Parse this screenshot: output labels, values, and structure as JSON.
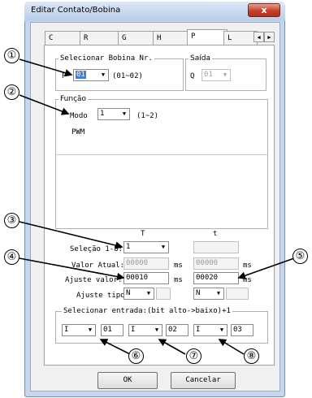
{
  "window": {
    "title": "Editar Contato/Bobina",
    "close_glyph": "x"
  },
  "tabs": [
    {
      "label": "C"
    },
    {
      "label": "R"
    },
    {
      "label": "G"
    },
    {
      "label": "H"
    },
    {
      "label": "P"
    },
    {
      "label": "L"
    }
  ],
  "tab_scroll": {
    "left": "◀",
    "right": "▶"
  },
  "bobina": {
    "legend": "Selecionar Bobina Nr.",
    "prefix": "P",
    "value": "01",
    "range": "(01~02)"
  },
  "saida": {
    "legend": "Saída",
    "prefix": "Q",
    "value": "01"
  },
  "funcao": {
    "legend": "Função",
    "modo_label": "Modo",
    "modo_value": "1",
    "modo_range": "(1~2)",
    "mode_name": "PWM"
  },
  "columns": {
    "T": "T",
    "t": "t"
  },
  "rows": {
    "selecao_label": "Seleção 1-8:",
    "selecao_value": "1",
    "valor_atual_label": "Valor Atual:",
    "valor_atual_T": "00000",
    "valor_atual_t": "00000",
    "ajuste_valor_label": "Ajuste valor:",
    "ajuste_valor_T": "00010",
    "ajuste_valor_t": "00020",
    "unit": "ms",
    "ajuste_tipo_label": "Ajuste tipo:",
    "ajuste_tipo_T": "N",
    "ajuste_tipo_t": "N"
  },
  "entrada": {
    "legend": "Selecionar entrada:(bit alto->baixo)+1",
    "items": [
      {
        "type": "I",
        "num": "01"
      },
      {
        "type": "I",
        "num": "02"
      },
      {
        "type": "I",
        "num": "03"
      }
    ]
  },
  "buttons": {
    "ok": "OK",
    "cancel": "Cancelar"
  },
  "callouts": [
    "①",
    "②",
    "③",
    "④",
    "⑤",
    "⑥",
    "⑦",
    "⑧"
  ],
  "dropdown_glyph": "▼"
}
